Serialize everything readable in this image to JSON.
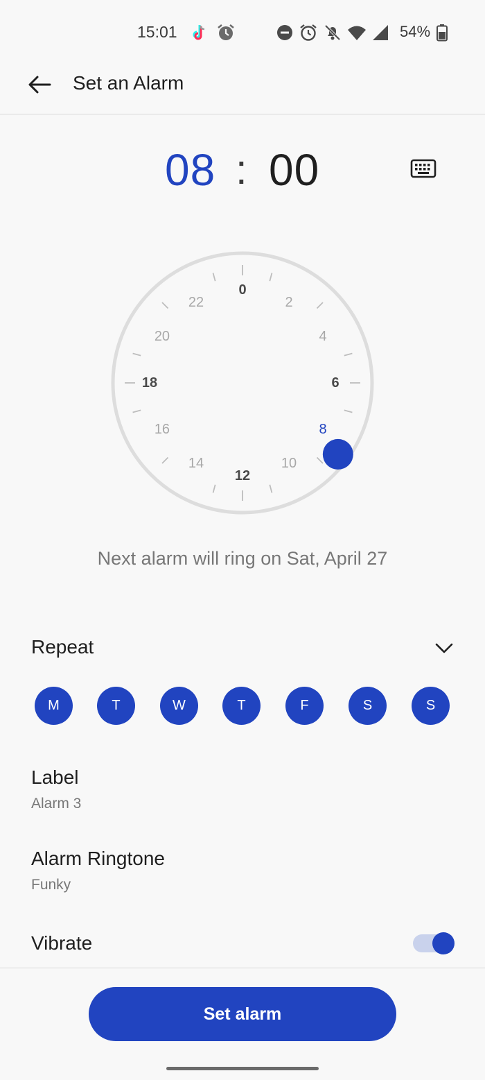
{
  "status_bar": {
    "time": "15:01",
    "battery": "54%",
    "icons": [
      "tiktok-icon",
      "alarm-icon",
      "do-not-disturb-icon",
      "alarm-icon",
      "bell-off-icon",
      "wifi-icon",
      "signal-icon",
      "battery-icon"
    ]
  },
  "header": {
    "title": "Set an Alarm"
  },
  "time": {
    "hour": "08",
    "separator": ":",
    "minute": "00"
  },
  "dial": {
    "labels": [
      "0",
      "2",
      "4",
      "6",
      "8",
      "10",
      "12",
      "14",
      "16",
      "18",
      "20",
      "22"
    ],
    "selected_hour": 8,
    "accent": "#2144c0"
  },
  "next_alarm": {
    "text": "Next alarm will ring on  Sat, April 27"
  },
  "repeat": {
    "label": "Repeat",
    "days": [
      "M",
      "T",
      "W",
      "T",
      "F",
      "S",
      "S"
    ]
  },
  "label_setting": {
    "title": "Label",
    "value": "Alarm 3"
  },
  "ringtone_setting": {
    "title": "Alarm Ringtone",
    "value": "Funky"
  },
  "vibrate": {
    "label": "Vibrate",
    "enabled": true
  },
  "action": {
    "set_alarm": "Set alarm"
  },
  "colors": {
    "accent": "#2144c0",
    "background": "#f8f8f8",
    "muted_text": "#777777"
  }
}
